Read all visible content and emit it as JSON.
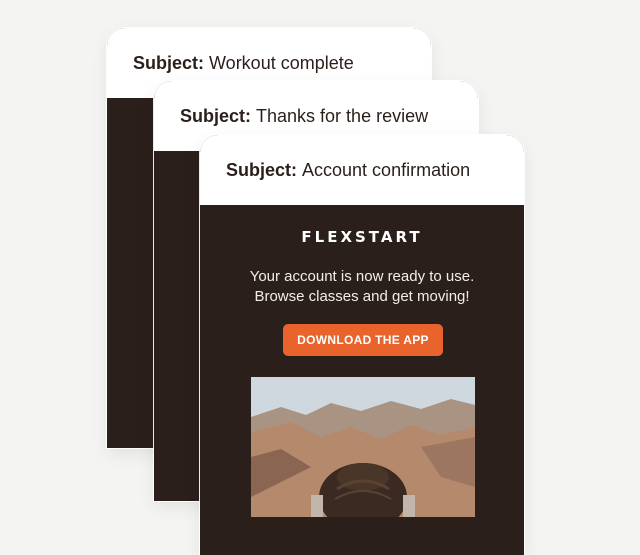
{
  "emails": [
    {
      "subject_label": "Subject:",
      "subject": "Workout complete"
    },
    {
      "subject_label": "Subject:",
      "subject": "Thanks for the review"
    },
    {
      "subject_label": "Subject:",
      "subject": "Account confirmation",
      "brand": "FLEXSTART",
      "message_line_1": "Your account is now ready to use.",
      "message_line_2": "Browse classes and get moving!",
      "cta_label": "DOWNLOAD THE APP"
    }
  ],
  "colors": {
    "page_background": "#f4f4f2",
    "email_body": "#2a1f1b",
    "header_background": "#ffffff",
    "cta_background": "#e8642c",
    "cta_text": "#ffffff"
  }
}
